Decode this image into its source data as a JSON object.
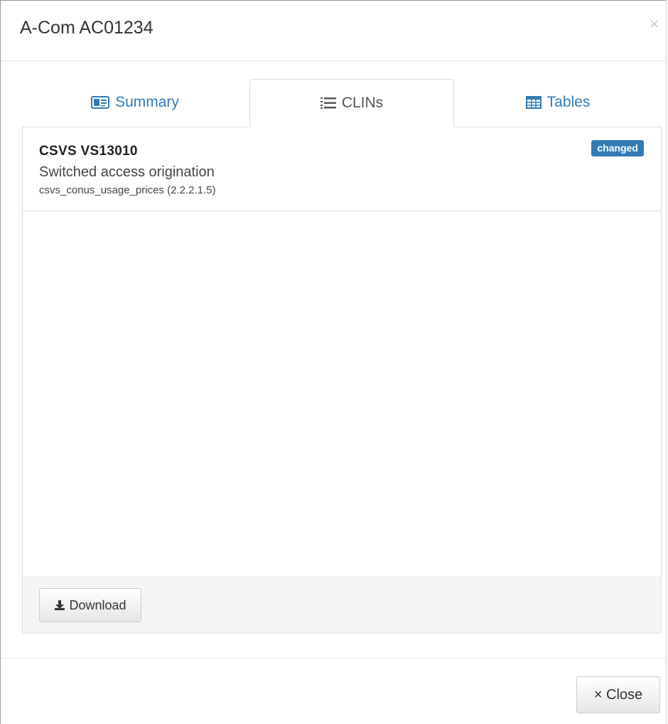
{
  "modal": {
    "title": "A-Com AC01234",
    "close_glyph": "×"
  },
  "tabs": [
    {
      "label": "Summary",
      "icon": "id-card-icon",
      "active": false
    },
    {
      "label": "CLINs",
      "icon": "list-icon",
      "active": true
    },
    {
      "label": "Tables",
      "icon": "table-icon",
      "active": false
    }
  ],
  "clin": {
    "code": "CSVS VS13010",
    "description": "Switched access origination",
    "table_ref": "csvs_conus_usage_prices (2.2.2.1.5)",
    "badge": "changed"
  },
  "panel_footer": {
    "download_label": "Download"
  },
  "footer": {
    "close_label": "× Close"
  },
  "colors": {
    "link": "#337ab7",
    "badge": "#337ab7",
    "footer_bg": "#f5f5f5"
  }
}
